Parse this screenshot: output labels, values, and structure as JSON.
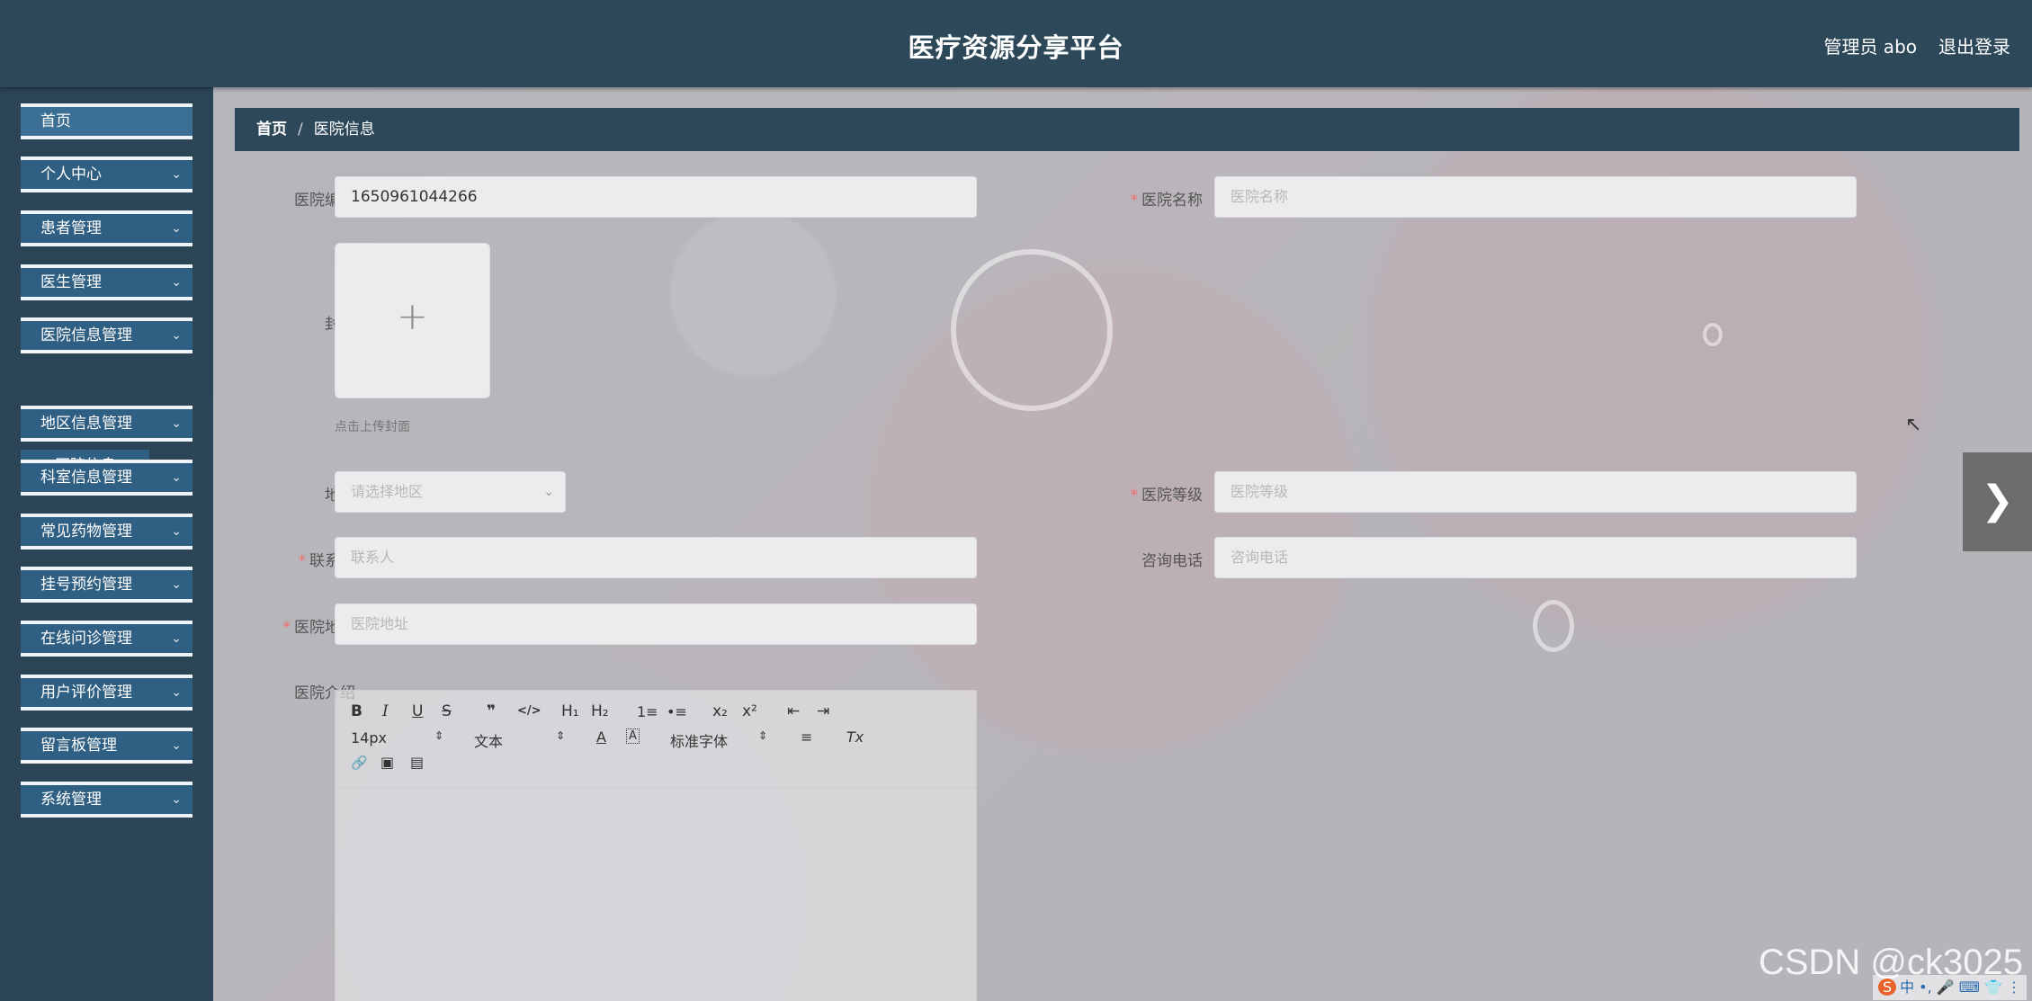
{
  "header": {
    "title": "医疗资源分享平台",
    "user": "管理员 abo",
    "logout": "退出登录"
  },
  "sidebar": {
    "items": [
      {
        "label": "首页"
      },
      {
        "label": "个人中心"
      },
      {
        "label": "患者管理"
      },
      {
        "label": "医生管理"
      },
      {
        "label": "医院信息管理"
      },
      {
        "label": "地区信息管理"
      },
      {
        "label": "科室信息管理"
      },
      {
        "label": "常见药物管理"
      },
      {
        "label": "挂号预约管理"
      },
      {
        "label": "在线问诊管理"
      },
      {
        "label": "用户评价管理"
      },
      {
        "label": "留言板管理"
      },
      {
        "label": "系统管理"
      }
    ],
    "submenu": {
      "label": "医院信息"
    }
  },
  "breadcrumb": {
    "home": "首页",
    "separator": "/",
    "current": "医院信息"
  },
  "form": {
    "hospital_no": {
      "label": "医院编号",
      "value": "1650961044266"
    },
    "hospital_name": {
      "label": "医院名称",
      "placeholder": "医院名称"
    },
    "cover": {
      "label": "封面",
      "hint": "点击上传封面"
    },
    "region": {
      "label": "地区",
      "placeholder": "请选择地区"
    },
    "level": {
      "label": "医院等级",
      "placeholder": "医院等级"
    },
    "contact": {
      "label": "联系人",
      "placeholder": "联系人"
    },
    "phone": {
      "label": "咨询电话",
      "placeholder": "咨询电话"
    },
    "address": {
      "label": "医院地址",
      "placeholder": "医院地址"
    },
    "intro": {
      "label": "医院介绍"
    }
  },
  "editor": {
    "font_size": "14px",
    "header_select": "文本",
    "font_family": "标准字体",
    "bold": "B",
    "italic": "I",
    "underline": "U",
    "strike": "S",
    "quote": "❞",
    "code": "</>",
    "h1": "H₁",
    "h2": "H₂",
    "ordered": "1≡",
    "bullet": "•≡",
    "sub": "x₂",
    "sup": "x²",
    "outdent": "⇤",
    "indent": "⇥",
    "color": "A",
    "bg": "A",
    "align": "≡",
    "clean": "Tx",
    "link": "🔗",
    "image": "▣",
    "video": "▤"
  },
  "watermark": "CSDN @ck3025",
  "tray": {
    "ime": "S",
    "text": "中 •, 🎤 ⌨ 👕 ⋮"
  }
}
